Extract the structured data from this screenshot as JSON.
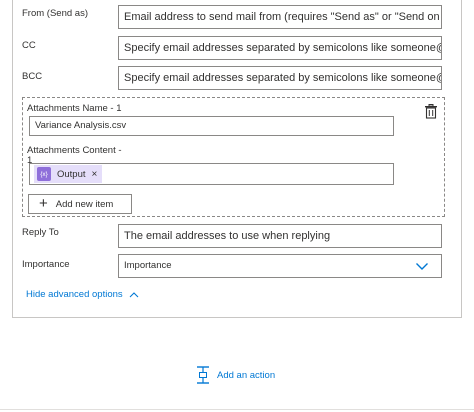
{
  "fields": {
    "from": {
      "label": "From (Send as)",
      "placeholder": "Email address to send mail from (requires \"Send as\" or \"Send on beh"
    },
    "cc": {
      "label": "CC",
      "placeholder": "Specify email addresses separated by semicolons like someone@con"
    },
    "bcc": {
      "label": "BCC",
      "placeholder": "Specify email addresses separated by semicolons like someone@con"
    },
    "attachments_name": {
      "label": "Attachments Name - 1",
      "value": "Variance Analysis.csv"
    },
    "attachments_content": {
      "label": "Attachments Content -",
      "label_line2": "1",
      "token_label": "Output",
      "token_icon": "{x}",
      "token_remove": "×"
    },
    "add_new_item": {
      "label": "Add new item"
    },
    "reply_to": {
      "label": "Reply To",
      "placeholder": "The email addresses to use when replying"
    },
    "importance": {
      "label": "Importance",
      "value": "Importance"
    }
  },
  "advanced": {
    "label": "Hide advanced options"
  },
  "add_action": {
    "label": "Add an action"
  },
  "colors": {
    "accent": "#0078d4",
    "token_bg": "#e5defa",
    "token_icon": "#8f6fda",
    "border": "#8a8886"
  }
}
